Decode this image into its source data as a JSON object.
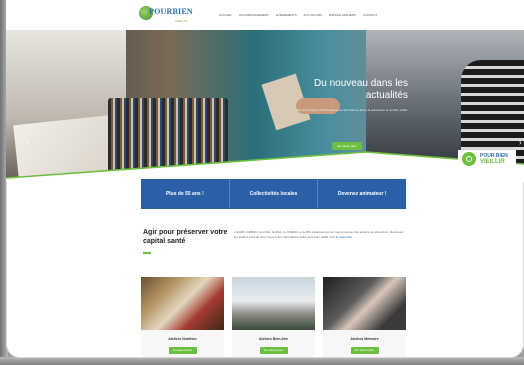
{
  "logo": {
    "word": "POURBIEN",
    "tagline": "VIEILLIR"
  },
  "nav": [
    "Accueil",
    "Accompagnement",
    "Evénements",
    "Actualités",
    "Espace ateliers",
    "Contact"
  ],
  "hero": {
    "title": "Du nouveau dans les actualités",
    "text": "Vous avez besoin d'informations sur des thèmes liés à la prévention et au bien vieillir.",
    "button": "En savoir plus",
    "prev_icon": "chevron-left-icon",
    "next_icon": "chevron-right-icon"
  },
  "badge": {
    "line1": "POUR BIEN",
    "line2": "VIEILLIR"
  },
  "tiles": [
    "Plus de 55 ans !",
    "Collectivités locales",
    "Devenez animateur !"
  ],
  "intro": {
    "title": "Agir pour préserver votre capital santé",
    "text": "L'AGIRC-ARRCO, la CNAV, la MSA, la CNRACL et le RSI s'associent pour vous proposer des actions de prévention. Retrouvez les ateliers près de chez vous et les informations utiles pour bien vieillir.",
    "link": "Voir le calendrier"
  },
  "cards": [
    {
      "caption": "Ateliers Nutrition",
      "button": "En savoir plus"
    },
    {
      "caption": "Ateliers Bien-être",
      "button": "En savoir plus"
    },
    {
      "caption": "Ateliers Mémoire",
      "button": "En savoir plus"
    }
  ],
  "colors": {
    "blue": "#2b5fa8",
    "green": "#6dbf3f"
  }
}
